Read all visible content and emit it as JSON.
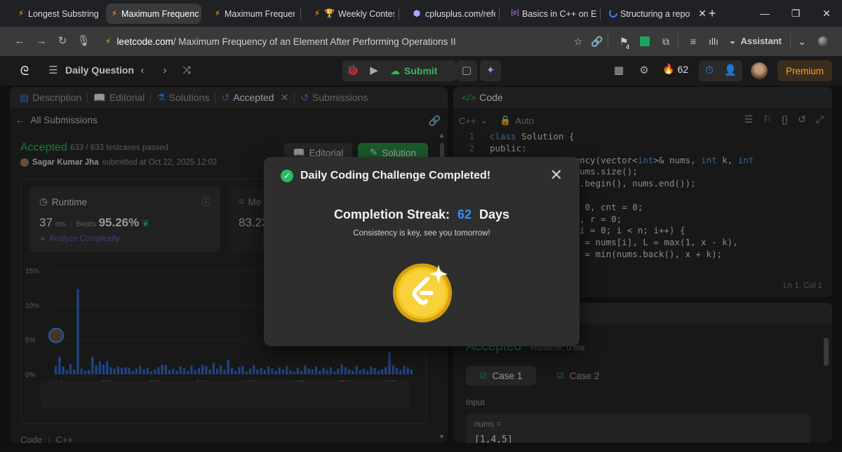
{
  "browser": {
    "tabs": [
      {
        "label": "Longest Substring w",
        "icon": "leetcode-icon"
      },
      {
        "label": "Maximum Frequenc",
        "icon": "leetcode-icon",
        "active": true
      },
      {
        "label": "Maximum Frequenc",
        "icon": "leetcode-icon"
      },
      {
        "label": "Weekly Contest",
        "icon": "trophy-icon"
      },
      {
        "label": "cplusplus.com/refe",
        "icon": "cplusplus-icon"
      },
      {
        "label": "Basics in C++ on Ed",
        "icon": "ed-icon"
      },
      {
        "label": "Structuring a repos",
        "icon": "loading-icon"
      }
    ],
    "url_domain": "leetcode.com",
    "url_path": " / Maximum Frequency of an Element After Performing Operations II",
    "assistant_label": "Assistant",
    "flag_badge": "4"
  },
  "lc": {
    "daily_question": "Daily Question",
    "submit_label": "Submit",
    "streak_count": "62",
    "premium_label": "Premium"
  },
  "left_panel": {
    "tabs": {
      "description": "Description",
      "editorial": "Editorial",
      "solutions": "Solutions",
      "accepted": "Accepted",
      "submissions": "Submissions"
    },
    "all_submissions": "All Submissions",
    "status": "Accepted",
    "testcases": "633 / 633 testcases passed",
    "user_name": "Sagar Kumar Jha",
    "submitted_at": "submitted at Oct 22, 2025 12:02",
    "editorial_btn": "Editorial",
    "solution_btn": "Solution",
    "runtime_label": "Runtime",
    "runtime_value": "37",
    "runtime_unit": "ms",
    "beats_label": "Beats",
    "beats_value": "95.26%",
    "analyze_label": "Analyze Complexity",
    "memory_label": "Me",
    "memory_value": "83.23",
    "bottom_tab_code": "Code",
    "bottom_tab_lang": "C++"
  },
  "chart_data": {
    "type": "bar",
    "y_ticks": [
      "15%",
      "10%",
      "5%",
      "0%"
    ],
    "x_ticks": [
      "14ms",
      "311ms",
      "608ms",
      "904ms",
      "1201ms",
      "1497ms",
      "1794ms",
      "2091ms"
    ],
    "ylim": [
      0,
      15
    ],
    "values": [
      1.2,
      2.5,
      1.1,
      0.6,
      1.5,
      0.7,
      12.3,
      0.8,
      0.5,
      0.6,
      2.5,
      1.3,
      1.8,
      1.4,
      1.9,
      1.0,
      0.8,
      1.1,
      0.9,
      1.0,
      0.9,
      0.5,
      0.8,
      1.2,
      0.7,
      0.9,
      0.4,
      0.7,
      1.0,
      1.4,
      1.3,
      0.6,
      0.8,
      0.5,
      1.1,
      0.9,
      0.5,
      1.2,
      0.6,
      0.9,
      1.4,
      1.2,
      0.7,
      1.6,
      0.8,
      1.3,
      0.6,
      2.1,
      0.9,
      0.5,
      1.0,
      1.2,
      0.4,
      0.8,
      1.3,
      0.7,
      0.9,
      0.6,
      1.1,
      0.8,
      0.5,
      1.0,
      0.7,
      1.2,
      0.6,
      0.4,
      0.9,
      0.5,
      1.3,
      0.8,
      0.7,
      1.1,
      0.5,
      0.9,
      0.6,
      1.0,
      0.4,
      0.8,
      1.4,
      1.0,
      0.7,
      0.5,
      1.2,
      0.6,
      0.8,
      0.5,
      1.1,
      0.9,
      0.5,
      0.7,
      1.0,
      3.2,
      1.3,
      0.9,
      0.6,
      1.2,
      1.0,
      0.7
    ]
  },
  "code_panel": {
    "title": "Code",
    "language": "C++",
    "auto": "Auto",
    "cursor": "Ln 1, Col 1",
    "lines": [
      {
        "n": "1",
        "text": "class Solution {"
      },
      {
        "n": "2",
        "text": "public:"
      },
      {
        "n": "3",
        "text": "    int maxFrequency(vector<int>& nums, int k, int"
      },
      {
        "n": "4",
        "text": "        int n = nums.size();"
      },
      {
        "n": "5",
        "text": "        sort(nums.begin(), nums.end());"
      },
      {
        "n": "6",
        "text": ""
      },
      {
        "n": "7",
        "text": "        int ans = 0, cnt = 0;"
      },
      {
        "n": "8",
        "text": "        int l = 0, r = 0;"
      },
      {
        "n": "9",
        "text": "        for (int i = 0; i < n; i++) {"
      },
      {
        "n": "10",
        "text": "            int x = nums[i], L = max(1, x - k),"
      },
      {
        "n": "11",
        "text": "                R = min(nums.back(), x + k);"
      }
    ]
  },
  "result_panel": {
    "status": "Accepted",
    "runtime": "Runtime: 0 ms",
    "case1": "Case 1",
    "case2": "Case 2",
    "input_label": "Input",
    "nums_label": "nums =",
    "nums_value": "[1,4,5]"
  },
  "modal": {
    "title": "Daily Coding Challenge Completed!",
    "streak_label": "Completion Streak:",
    "streak_value": "62",
    "streak_unit": "Days",
    "message": "Consistency is key, see you tomorrow!"
  },
  "colors": {
    "accent_green": "#2cbb5d",
    "streak_blue": "#3a8ef6",
    "coin_gold": "#f5c518"
  }
}
